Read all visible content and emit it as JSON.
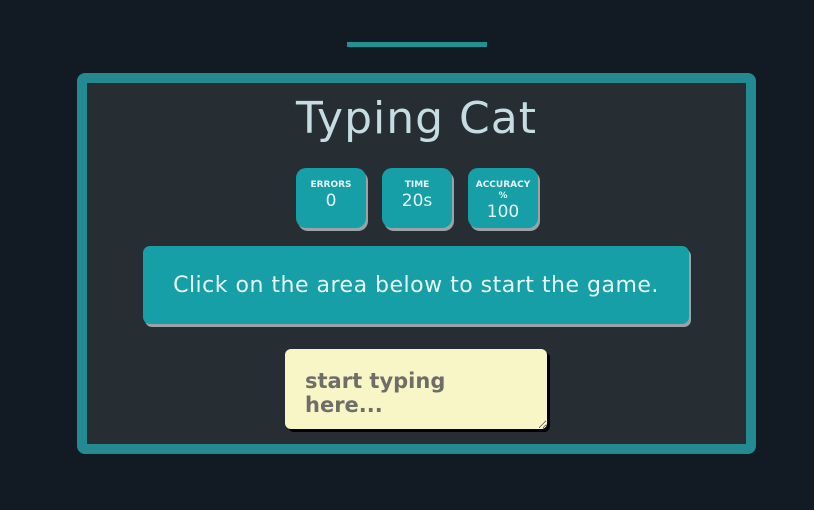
{
  "game": {
    "title": "Typing Cat",
    "stats": {
      "errors": {
        "label": "ERRORS",
        "value": "0"
      },
      "time": {
        "label": "TIME",
        "value": "20s"
      },
      "accuracy": {
        "label": "ACCURACY %",
        "value": "100"
      }
    },
    "message": "Click on the area below to start the game.",
    "input": {
      "value": "",
      "placeholder": "start typing here..."
    }
  },
  "colors": {
    "background": "#121a24",
    "frame_border": "#238a91",
    "panel": "#262d33",
    "accent": "#169fa6",
    "title_text": "#c5dde2",
    "input_bg": "#f8f5c6"
  }
}
